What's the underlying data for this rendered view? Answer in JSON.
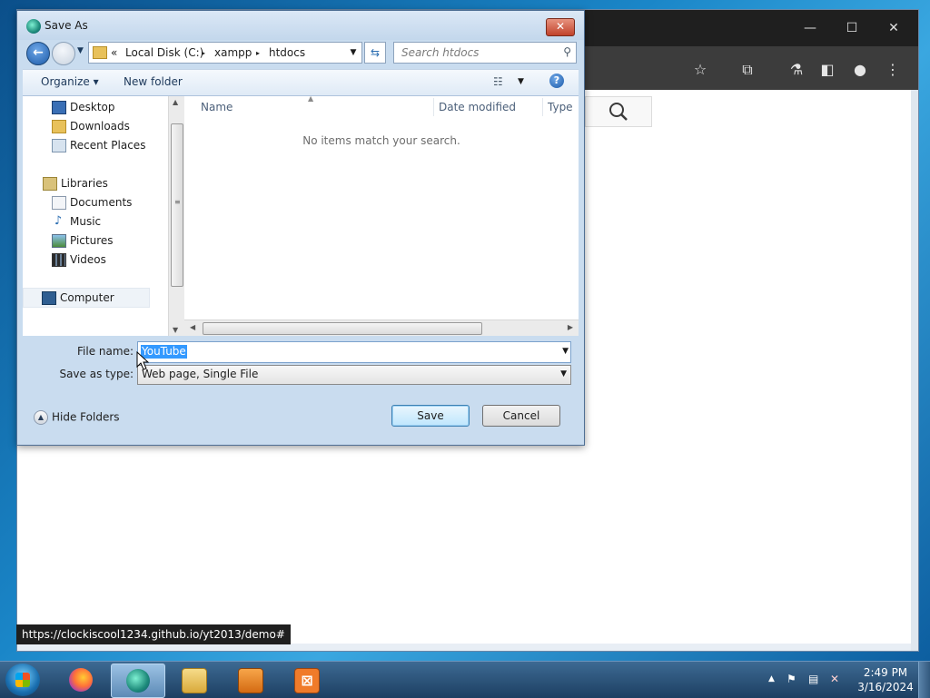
{
  "browser": {
    "status_url": "https://clockiscool1234.github.io/yt2013/demo#"
  },
  "dialog": {
    "title": "Save As",
    "close_label": "✕",
    "breadcrumb": {
      "overflow": "«",
      "items": [
        "Local Disk (C:)",
        "xampp",
        "htdocs"
      ],
      "separator": "▸"
    },
    "search_placeholder": "Search htdocs",
    "toolbar": {
      "organize_label": "Organize ▾",
      "new_folder_label": "New folder",
      "help_label": "?"
    },
    "nav": {
      "items": [
        {
          "label": "Desktop",
          "icon": "desktop-icon"
        },
        {
          "label": "Downloads",
          "icon": "downloads-folder-icon"
        },
        {
          "label": "Recent Places",
          "icon": "recent-places-icon"
        },
        {
          "label": "Libraries",
          "icon": "libraries-icon"
        },
        {
          "label": "Documents",
          "icon": "documents-icon"
        },
        {
          "label": "Music",
          "icon": "music-icon"
        },
        {
          "label": "Pictures",
          "icon": "pictures-icon"
        },
        {
          "label": "Videos",
          "icon": "videos-icon"
        },
        {
          "label": "Computer",
          "icon": "computer-icon"
        }
      ]
    },
    "columns": [
      "Name",
      "Date modified",
      "Type"
    ],
    "empty_message": "No items match your search.",
    "file_name_label": "File name:",
    "file_name_value": "YouTube",
    "save_as_type_label": "Save as type:",
    "save_as_type_value": "Web page, Single File",
    "hide_folders_label": "Hide Folders",
    "save_label": "Save",
    "cancel_label": "Cancel"
  },
  "taskbar": {
    "time": "2:49 PM",
    "date": "3/16/2024"
  },
  "colors": {
    "selection": "#3399ff",
    "dialog_frame": "#c9dcef",
    "taskbar": "#1d3f62"
  }
}
